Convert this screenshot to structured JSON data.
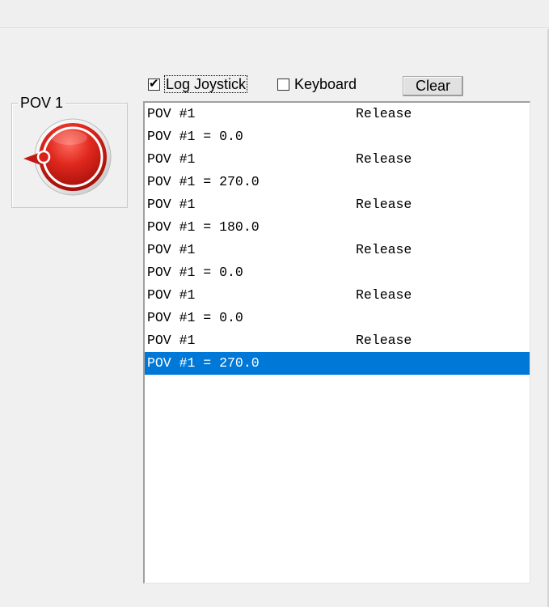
{
  "pov_group": {
    "label": "POV 1"
  },
  "options": {
    "log_joystick": {
      "label": "Log Joystick",
      "checked": true
    },
    "keyboard": {
      "label": "Keyboard",
      "checked": false
    }
  },
  "buttons": {
    "clear_label": "Clear"
  },
  "colors": {
    "selection": "#0078d7",
    "pov_red": "#e0281e"
  },
  "log": {
    "selected_index": 11,
    "rows": [
      {
        "text": "POV #1",
        "event": "Release"
      },
      {
        "text": "POV #1 = 0.0",
        "event": ""
      },
      {
        "text": "POV #1",
        "event": "Release"
      },
      {
        "text": "POV #1 = 270.0",
        "event": ""
      },
      {
        "text": "POV #1",
        "event": "Release"
      },
      {
        "text": "POV #1 = 180.0",
        "event": ""
      },
      {
        "text": "POV #1",
        "event": "Release"
      },
      {
        "text": "POV #1 = 0.0",
        "event": ""
      },
      {
        "text": "POV #1",
        "event": "Release"
      },
      {
        "text": "POV #1 = 0.0",
        "event": ""
      },
      {
        "text": "POV #1",
        "event": "Release"
      },
      {
        "text": "POV #1 = 270.0",
        "event": ""
      }
    ]
  }
}
